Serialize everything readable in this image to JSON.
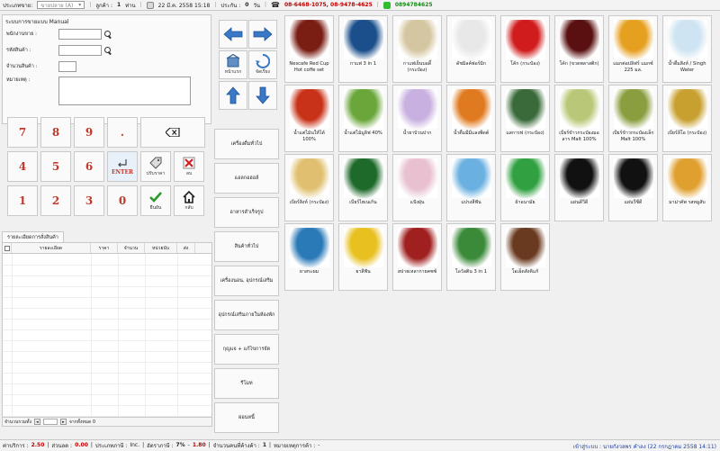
{
  "topbar": {
    "sale_type_label": "ประเภทขาย:",
    "sale_type_value": "ขายปลาย (A)",
    "customer_label": "ลูกค้า :",
    "customer_value": "1",
    "customer_unit": "ท่าน",
    "date": "22 มี.ค. 2558 15:18",
    "receipt_label": "ประกัน :",
    "receipt_value": "0",
    "receipt_unit": "วัน",
    "phones": "08-6468-1075, 08-9478-4625",
    "line_id": "0894784625"
  },
  "form": {
    "title": "ระบบการขายแบบ Manual",
    "employee_label": "พนักงานขาย :",
    "product_code_label": "รหัสสินค้า :",
    "quantity_label": "จำนวนสินค้า :",
    "note_label": "หมายเหตุ :"
  },
  "keypad": {
    "k7": "7",
    "k8": "8",
    "k9": "9",
    "kdot": ".",
    "k4": "4",
    "k5": "5",
    "k6": "6",
    "k1": "1",
    "k2": "2",
    "k3": "3",
    "k0": "0",
    "enter": "ENTER",
    "price_adjust": "ปรับราคา",
    "delete": "ลบ",
    "confirm": "ยืนยัน",
    "back": "กลับ"
  },
  "orderlist": {
    "tab": "รายละเอียดการสั่งสินค้า",
    "columns": [
      "",
      "รายละเอียด",
      "ราคา",
      "จำนวน",
      "หน่วยนับ",
      "ส่ง"
    ],
    "total_items": "จำนวนรวมทั้ง",
    "footer_right": "จากทั้งหมด 0"
  },
  "nav": {
    "home_label": "หน้าแรก",
    "sort_label": "จัดเรียง",
    "categories": [
      "เครื่องดื่มทั่วไป",
      "แอลกอฮอล์",
      "อาหารสำเร็จรูป",
      "สินค้าทั่วไป",
      "เครื่องนอน, อุปกรณ์เสริม",
      "อุปกรณ์เสริมภายในห้องพัก",
      "กุญแจ + แก้ไขการจัด",
      "รีโมท",
      "ผ่อนหนี้"
    ]
  },
  "products": [
    {
      "name": "Nescafe Red Cup Hot coffe set",
      "color": "#7a1e14"
    },
    {
      "name": "กาแฟ 3 in 1",
      "color": "#1b4f8c"
    },
    {
      "name": "กาแฟเย็นบอดี้ (กระป๋อง)",
      "color": "#d4c6a0"
    },
    {
      "name": "ดัชมิลค์ฟอร์มิก",
      "color": "#e8e8e8"
    },
    {
      "name": "โค้ก (กระป๋อง)",
      "color": "#d01c1c"
    },
    {
      "name": "โค้ก (ขวดพลาสติก)",
      "color": "#5a1010"
    },
    {
      "name": "แมกต่อปลิฟร์ แมกซ์ 225 มล.",
      "color": "#e6a020"
    },
    {
      "name": "น้ำดื่มสิงห์ / Singh Water",
      "color": "#cfe4f2"
    },
    {
      "name": "น้ำแต่ไม้นให้ได้ 100%",
      "color": "#c83218"
    },
    {
      "name": "น้ำแต่ไม้มูลิฟ 40%",
      "color": "#6aa63a"
    },
    {
      "name": "น้ำยาบ้วนปาก",
      "color": "#c8b0e0"
    },
    {
      "name": "น้ำดื่มมีมีแลงพีดต์",
      "color": "#e07a20"
    },
    {
      "name": "แสการฟ (กระป๋อง)",
      "color": "#3a6a3a"
    },
    {
      "name": "เบียร์ข้าวกระป๋องมอลาร Malt 100%",
      "color": "#b8c878"
    },
    {
      "name": "เบียร์ข้าวกระป๋องเล็ก Malt 100%",
      "color": "#8a9e40"
    },
    {
      "name": "เบียร์ลีโอ (กระป๋อง)",
      "color": "#c8a030"
    },
    {
      "name": "เบียร์สิงห์ (กระป๋อง)",
      "color": "#e0c070"
    },
    {
      "name": "เบียร์ไฮเนเก้น",
      "color": "#1e6a2a"
    },
    {
      "name": "แป้งฝุ่น",
      "color": "#e8c0d0"
    },
    {
      "name": "แปรงสีฟัน",
      "color": "#6ab0e0"
    },
    {
      "name": "ผ้าอนามัย",
      "color": "#30a040"
    },
    {
      "name": "แผ่นดีวีดี",
      "color": "#111111"
    },
    {
      "name": "แผ่นวีซีดี",
      "color": "#111111"
    },
    {
      "name": "มาม่าคัพ รสหมูสับ",
      "color": "#e0a030"
    },
    {
      "name": "ยาสระผม",
      "color": "#2a7ab8"
    },
    {
      "name": "ยาสีฟัน",
      "color": "#e8c020"
    },
    {
      "name": "สปายเหลากายคซซ์",
      "color": "#a02020"
    },
    {
      "name": "โอวัลติน 3 in 1",
      "color": "#3a8a3a"
    },
    {
      "name": "โอเอ็ดสังคิแก้",
      "color": "#6a3a20"
    }
  ],
  "status": {
    "service_label": "ค่าบริการ :",
    "service_value": "2.50",
    "discount_label": "ส่วนลด :",
    "discount_value": "0.00",
    "tax_type_label": "ประเภทภาษี :",
    "tax_type_value": "Inc.",
    "tax_rate_label": "อัตราภาษี :",
    "tax_rate_value": "7%",
    "tax_amount_value": "1.80",
    "person_label": "จำนวนคนที่ค้างค้า :",
    "person_value": "1",
    "note_label": "หมายเหตุการค้า :",
    "note_value": "-",
    "login_info": "เข้าสู่ระบบ : นายกังวลพร คำลง (22 กรกฎาคม 2558 14:11)"
  }
}
